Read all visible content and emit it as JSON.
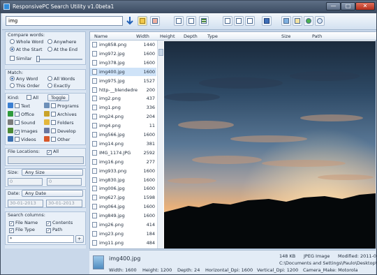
{
  "window": {
    "title": "ResponsivePC Search Utility v1.0beta1",
    "min_glyph": "—",
    "max_glyph": "□",
    "close_glyph": "✕"
  },
  "search": {
    "value": "img"
  },
  "sidebar": {
    "compare_words": {
      "title": "Compare words:",
      "options": [
        "Whole Word",
        "Anywhere",
        "At the Start",
        "At the End"
      ],
      "selected": "At the Start",
      "similar_label": "Similar"
    },
    "match": {
      "title": "Match:",
      "options": [
        "Any Word",
        "All Words",
        "This Order",
        "Exactly"
      ],
      "selected": "Any Word"
    },
    "kind": {
      "title": "Kind:",
      "all_label": "All",
      "toggle_label": "Toggle",
      "items": [
        {
          "label": "Text",
          "checked": false,
          "color": "#3b7fd1"
        },
        {
          "label": "Programs",
          "checked": false,
          "color": "#6c8fb8"
        },
        {
          "label": "Office",
          "checked": false,
          "color": "#2f9a3c"
        },
        {
          "label": "Archives",
          "checked": false,
          "color": "#c9a32a"
        },
        {
          "label": "Sound",
          "checked": false,
          "color": "#7c7c7c"
        },
        {
          "label": "Folders",
          "checked": false,
          "color": "#e4b73c"
        },
        {
          "label": "Images",
          "checked": true,
          "color": "#4c8a36"
        },
        {
          "label": "Develop",
          "checked": false,
          "color": "#6a77a0"
        },
        {
          "label": "Videos",
          "checked": false,
          "color": "#3a6fb0"
        },
        {
          "label": "Other",
          "checked": false,
          "color": "#d8582a"
        }
      ]
    },
    "file_locations": {
      "title": "File Locations:",
      "all_label": "All",
      "all_checked": true
    },
    "size": {
      "title": "Size:",
      "button": "Any Size",
      "min": "0",
      "max": "0"
    },
    "date": {
      "title": "Date:",
      "button": "Any Date",
      "from": "30-01-2013",
      "to": "30-01-2013"
    },
    "search_columns": {
      "title": "Search columns:",
      "items": [
        {
          "label": "File Name",
          "checked": true
        },
        {
          "label": "Contents",
          "checked": true
        },
        {
          "label": "File Type",
          "checked": true
        },
        {
          "label": "Path",
          "checked": true
        }
      ],
      "filter_value": "*",
      "add_label": "+"
    }
  },
  "columns": [
    "Name",
    "Width",
    "Height",
    "Depth",
    "Type",
    "Size",
    "Path"
  ],
  "files": [
    {
      "name": "img858.png",
      "width": "1440"
    },
    {
      "name": "img972.jpg",
      "width": "1600"
    },
    {
      "name": "img378.jpg",
      "width": "1600"
    },
    {
      "name": "img400.jpg",
      "width": "1600"
    },
    {
      "name": "img975.jpg",
      "width": "1527"
    },
    {
      "name": "http-__blendedre",
      "width": "200"
    },
    {
      "name": "img2.png",
      "width": "437"
    },
    {
      "name": "img1.png",
      "width": "336"
    },
    {
      "name": "img24.png",
      "width": "204"
    },
    {
      "name": "img4.png",
      "width": "11"
    },
    {
      "name": "img566.jpg",
      "width": "1600"
    },
    {
      "name": "img14.png",
      "width": "381"
    },
    {
      "name": "IMG_1174.JPG",
      "width": "2592"
    },
    {
      "name": "img16.png",
      "width": "277"
    },
    {
      "name": "img933.png",
      "width": "1600"
    },
    {
      "name": "img830.jpg",
      "width": "1600"
    },
    {
      "name": "img006.jpg",
      "width": "1600"
    },
    {
      "name": "img627.jpg",
      "width": "1598"
    },
    {
      "name": "img064.jpg",
      "width": "1600"
    },
    {
      "name": "img849.jpg",
      "width": "1600"
    },
    {
      "name": "img26.png",
      "width": "414"
    },
    {
      "name": "img23.png",
      "width": "184"
    },
    {
      "name": "img11.png",
      "width": "484"
    }
  ],
  "selected_file": "img400.jpg",
  "status": {
    "filename": "img400.jpg",
    "size": "148 KB",
    "type": "JPEG Image",
    "modified": "Modified: 2011-0",
    "path": "C:\\Documents and Settings\\Paulo\\Desktop\\Oth",
    "width": "Width: 1600",
    "height": "Height: 1200",
    "depth": "Depth: 24",
    "hdpi": "Horizontal_Dpi: 1600",
    "vdpi": "Vertical_Dpi: 1200",
    "camera": "Camera_Make: Motorola"
  }
}
